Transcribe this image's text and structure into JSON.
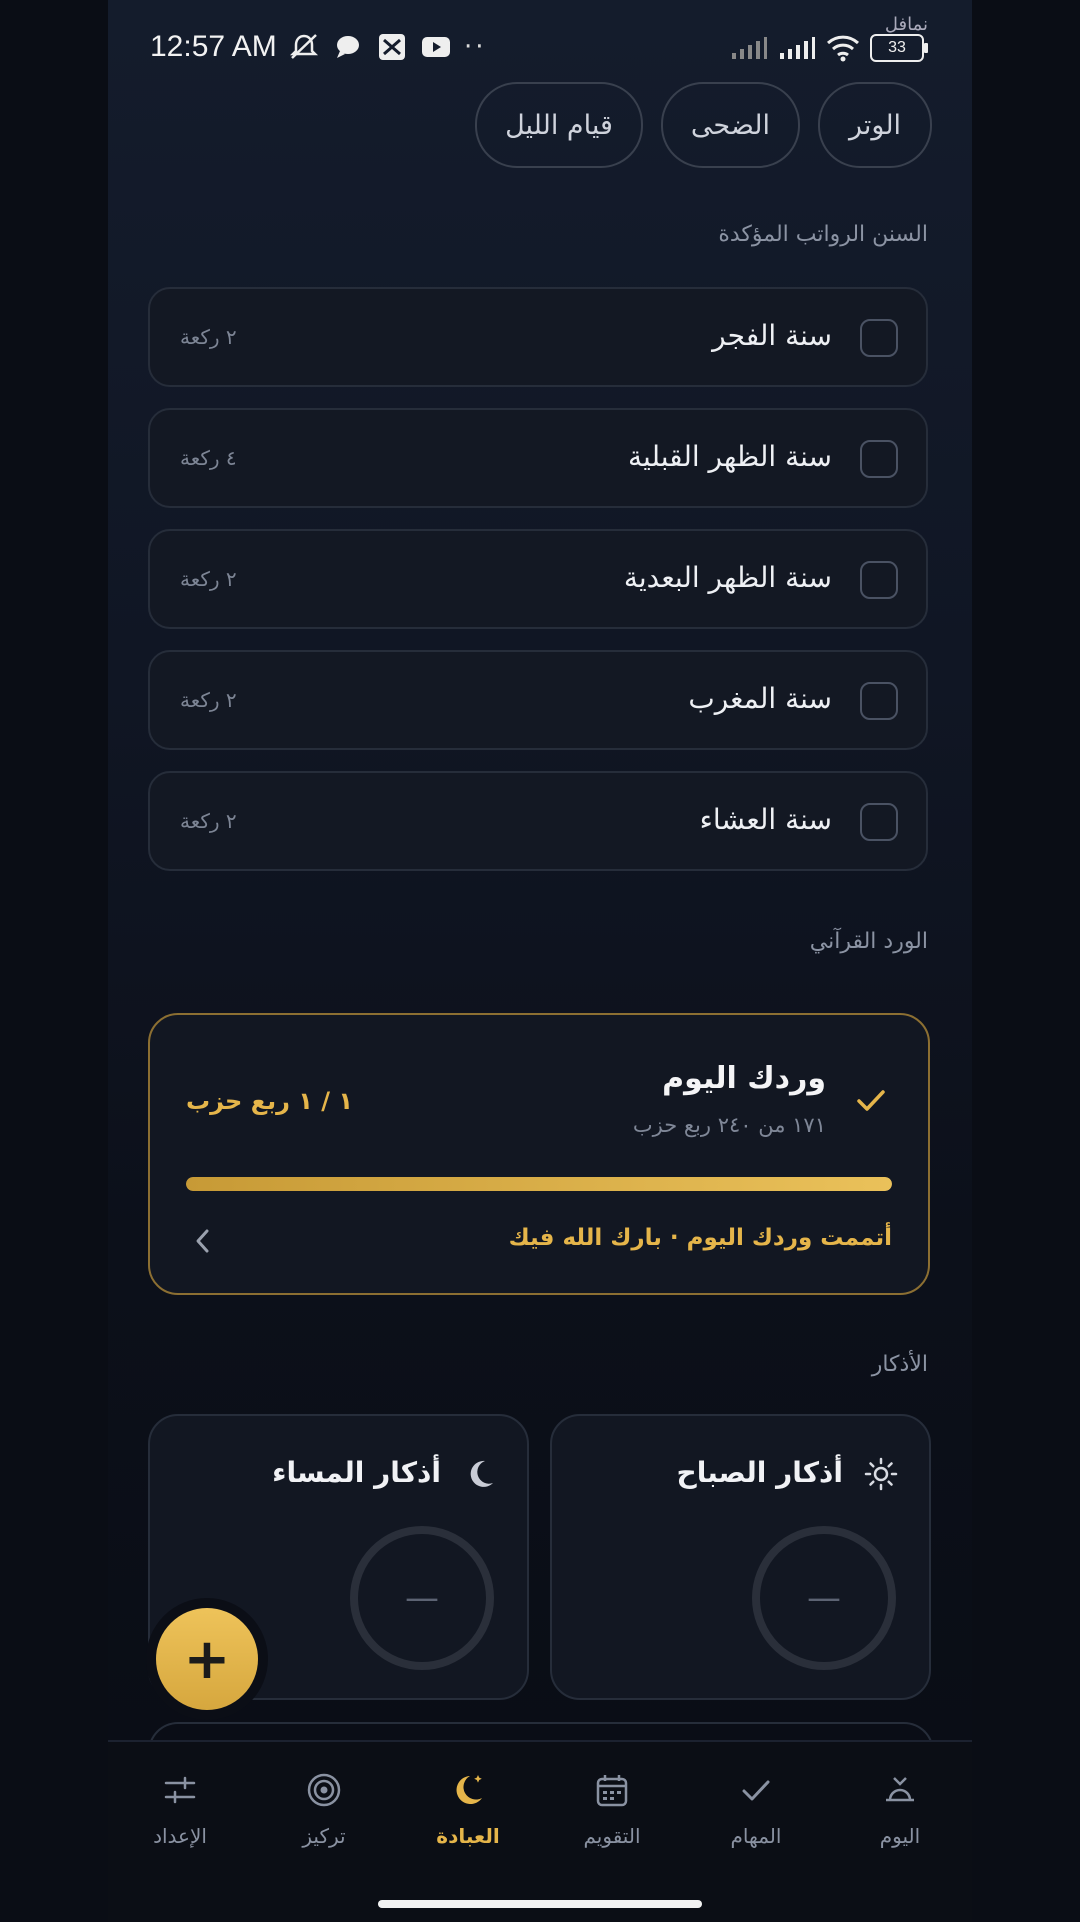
{
  "status_bar": {
    "time": "12:57 AM",
    "battery": "33",
    "notif_tag": "نمافل",
    "dots": "··"
  },
  "prayer_pills": [
    "الوتر",
    "الضحى",
    "قيام الليل"
  ],
  "sunnah": {
    "title": "السنن الرواتب المؤكدة",
    "items": [
      {
        "label": "سنة الفجر",
        "count": "٢ ركعة",
        "checked": false
      },
      {
        "label": "سنة الظهر القبلية",
        "count": "٤ ركعة",
        "checked": false
      },
      {
        "label": "سنة الظهر البعدية",
        "count": "٢ ركعة",
        "checked": false
      },
      {
        "label": "سنة المغرب",
        "count": "٢ ركعة",
        "checked": false
      },
      {
        "label": "سنة العشاء",
        "count": "٢ ركعة",
        "checked": false
      }
    ]
  },
  "quran": {
    "section_title": "الورد القرآني",
    "card_title": "وردك اليوم",
    "progress_text": "١٧١ من ٢٤٠ ربع حزب",
    "badge": "١ / ١ ربع حزب",
    "progress": 1.0,
    "message": "أتممت وردك اليوم · بارك الله فيك"
  },
  "adhkar": {
    "section_title": "الأذكار",
    "morning": {
      "title": "أذكار الصباح",
      "value": "—",
      "icon": "sun-icon"
    },
    "evening": {
      "title": "أذكار المساء",
      "value": "—",
      "icon": "moon-icon"
    }
  },
  "fab": {
    "label": "+"
  },
  "nav": {
    "active": "worship",
    "tabs": [
      {
        "id": "today",
        "label": "اليوم",
        "icon": "today-icon"
      },
      {
        "id": "tasks",
        "label": "المهام",
        "icon": "check-icon"
      },
      {
        "id": "calendar",
        "label": "التقويم",
        "icon": "calendar-icon"
      },
      {
        "id": "worship",
        "label": "العبادة",
        "icon": "crescent-icon"
      },
      {
        "id": "focus",
        "label": "تركيز",
        "icon": "target-icon"
      },
      {
        "id": "settings",
        "label": "الإعداد",
        "icon": "sliders-icon"
      }
    ]
  },
  "colors": {
    "accent": "#e5b54a",
    "card_border": "#262d3a",
    "background": "#0c101a"
  }
}
